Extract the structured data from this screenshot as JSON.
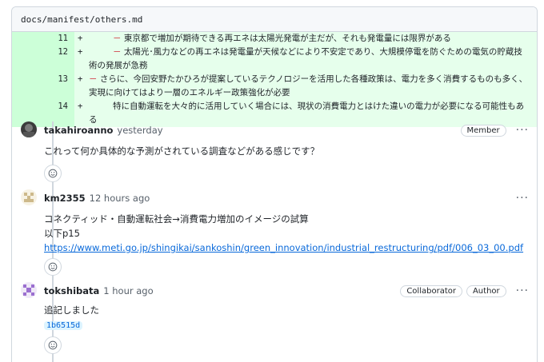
{
  "file": {
    "path": "docs/manifest/others.md"
  },
  "diff_lines": [
    {
      "num": "11",
      "sign": "+",
      "dash": "－",
      "text": "東京都で増加が期待できる再エネは太陽光発電が主だが、それも発電量には限界がある"
    },
    {
      "num": "12",
      "sign": "+",
      "dash": "－",
      "text": "太陽光･風力などの再エネは発電量が天候などにより不安定であり、大規模停電を防ぐための電気の貯蔵技術の発展が急務"
    },
    {
      "num": "13",
      "sign": "+",
      "dash": "－",
      "text": "さらに、今回安野たかひろが提案しているテクノロジーを活用した各種政策は、電力を多く消費するものも多く、実現に向けてはより一層のエネルギー政策強化が必要"
    },
    {
      "num": "14",
      "sign": "+",
      "dash": "",
      "text": "特に自動運転を大々的に活用していく場合には、現状の消費電力とはけた違いの電力が必要になる可能性もある"
    }
  ],
  "comments": [
    {
      "author": "takahiroanno",
      "time": "yesterday",
      "badges": [
        "Member"
      ],
      "lines": [
        "これって何か具体的な予測がされている調査などがある感じです？"
      ],
      "menu": "···"
    },
    {
      "author": "km2355",
      "time": "12 hours ago",
      "badges": [],
      "lines": [
        "コネクティッド・自動運転社会→消費電力増加のイメージの試算",
        "以下p15"
      ],
      "link": "https://www.meti.go.jp/shingikai/sankoshin/green_innovation/industrial_restructuring/pdf/006_03_00.pdf",
      "menu": "···"
    },
    {
      "author": "tokshibata",
      "time": "1 hour ago",
      "badges": [
        "Collaborator",
        "Author"
      ],
      "lines": [
        "追記しました"
      ],
      "commit": "1b6515d",
      "menu": "···"
    }
  ],
  "icons": {
    "reaction": "smiley-icon",
    "menu": "kebab-horizontal-icon"
  }
}
